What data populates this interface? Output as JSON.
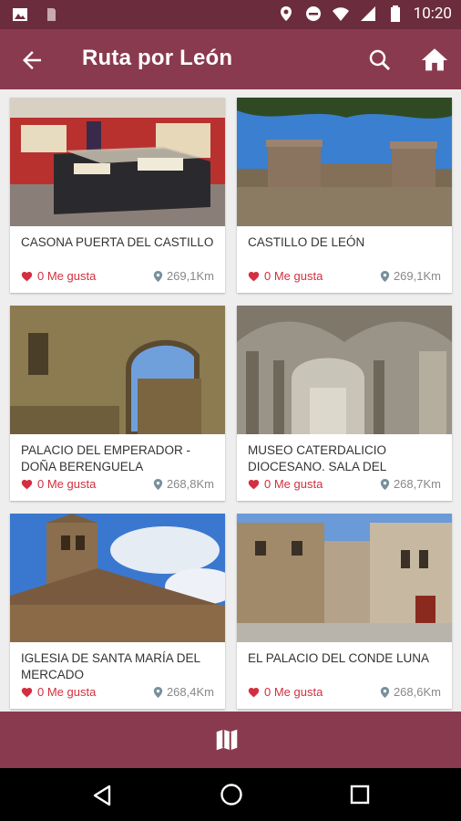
{
  "status_bar": {
    "time": "10:20",
    "icons": [
      "image-icon",
      "sim-icon",
      "location-icon",
      "dnd-icon",
      "wifi-icon",
      "signal-icon",
      "battery-icon"
    ]
  },
  "toolbar": {
    "title": "Ruta por León",
    "back_icon": "arrow-back-icon",
    "search_icon": "search-icon",
    "home_icon": "home-icon"
  },
  "places": [
    {
      "name": "CASONA PUERTA DEL CASTILLO",
      "likes": "0 Me gusta",
      "distance": "269,1Km"
    },
    {
      "name": "CASTILLO DE LEÓN",
      "likes": "0 Me gusta",
      "distance": "269,1Km"
    },
    {
      "name": "PALACIO DEL EMPERADOR - DOÑA BERENGUELA",
      "likes": "0 Me gusta",
      "distance": "268,8Km"
    },
    {
      "name": "MUSEO CATERDALICIO DIOCESANO. SALA DEL",
      "likes": "0 Me gusta",
      "distance": "268,7Km"
    },
    {
      "name": "IGLESIA DE SANTA MARÍA DEL MERCADO",
      "likes": "0 Me gusta",
      "distance": "268,4Km"
    },
    {
      "name": "EL PALACIO DEL CONDE LUNA",
      "likes": "0 Me gusta",
      "distance": "268,6Km"
    }
  ],
  "bottom_bar": {
    "map_icon": "map-icon"
  },
  "nav_bar": {
    "icons": [
      "nav-back-icon",
      "nav-home-icon",
      "nav-recents-icon"
    ]
  },
  "colors": {
    "status_bar": "#6b2d3e",
    "toolbar": "#8a3a4f",
    "like": "#d32f3f",
    "distance": "#888888",
    "background": "#eeeeee"
  }
}
